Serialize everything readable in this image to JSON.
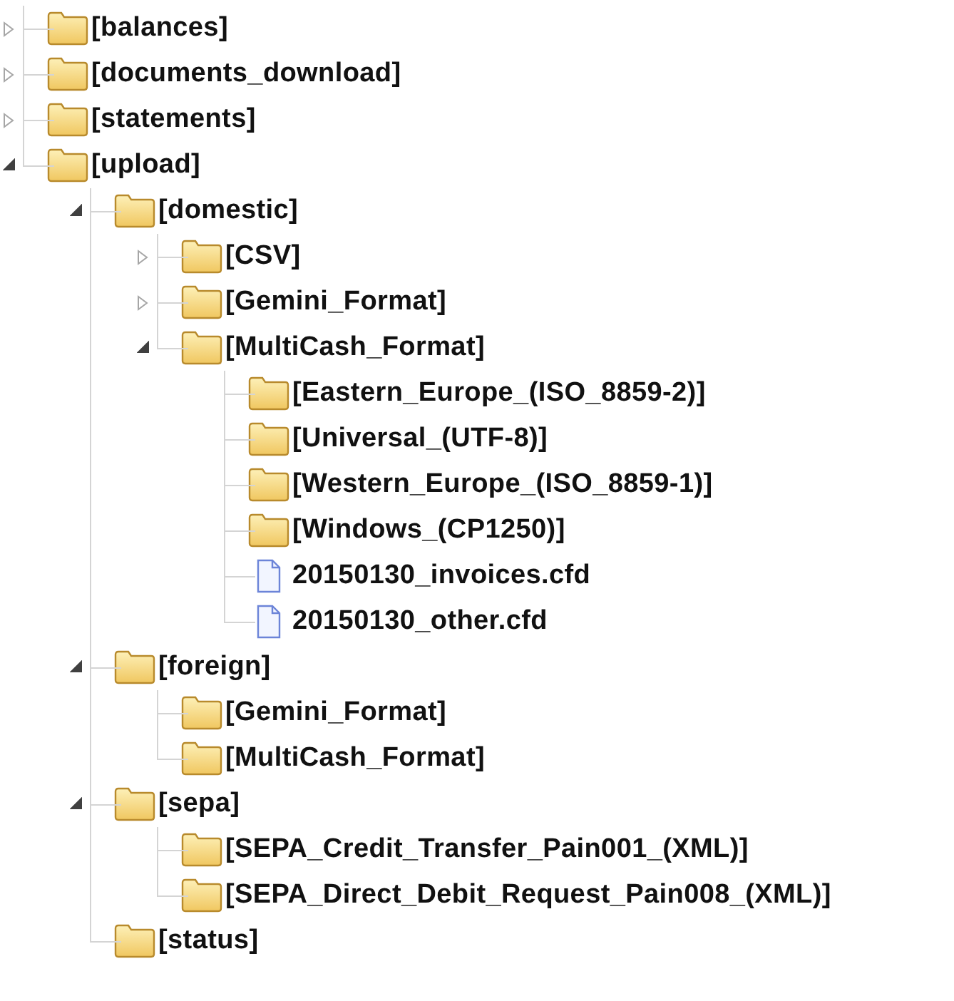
{
  "tree": [
    {
      "label": "[balances]",
      "kind": "folder",
      "expanded": false
    },
    {
      "label": "[documents_download]",
      "kind": "folder",
      "expanded": false
    },
    {
      "label": "[statements]",
      "kind": "folder",
      "expanded": false
    },
    {
      "label": "[upload]",
      "kind": "folder",
      "expanded": true,
      "children": [
        {
          "label": "[domestic]",
          "kind": "folder",
          "expanded": true,
          "children": [
            {
              "label": "[CSV]",
              "kind": "folder",
              "expanded": false
            },
            {
              "label": "[Gemini_Format]",
              "kind": "folder",
              "expanded": false
            },
            {
              "label": "[MultiCash_Format]",
              "kind": "folder",
              "expanded": true,
              "children": [
                {
                  "label": "[Eastern_Europe_(ISO_8859-2)]",
                  "kind": "folder"
                },
                {
                  "label": "[Universal_(UTF-8)]",
                  "kind": "folder"
                },
                {
                  "label": "[Western_Europe_(ISO_8859-1)]",
                  "kind": "folder"
                },
                {
                  "label": "[Windows_(CP1250)]",
                  "kind": "folder"
                },
                {
                  "label": "20150130_invoices.cfd",
                  "kind": "file"
                },
                {
                  "label": "20150130_other.cfd",
                  "kind": "file"
                }
              ]
            }
          ]
        },
        {
          "label": "[foreign]",
          "kind": "folder",
          "expanded": true,
          "children": [
            {
              "label": "[Gemini_Format]",
              "kind": "folder"
            },
            {
              "label": "[MultiCash_Format]",
              "kind": "folder"
            }
          ]
        },
        {
          "label": "[sepa]",
          "kind": "folder",
          "expanded": true,
          "children": [
            {
              "label": "[SEPA_Credit_Transfer_Pain001_(XML)]",
              "kind": "folder"
            },
            {
              "label": "[SEPA_Direct_Debit_Request_Pain008_(XML)]",
              "kind": "folder"
            }
          ]
        },
        {
          "label": "[status]",
          "kind": "folder"
        }
      ]
    }
  ]
}
